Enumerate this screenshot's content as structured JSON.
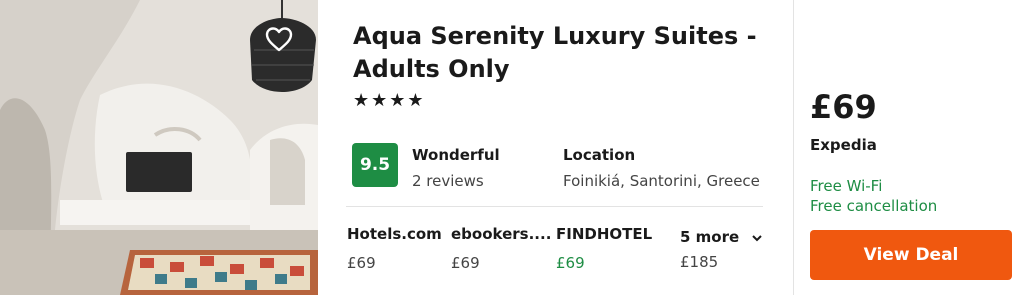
{
  "hotel": {
    "name": "Aqua Serenity Luxury Suites - Adults Only",
    "stars": "★★★★"
  },
  "rating": {
    "score": "9.5",
    "label": "Wonderful",
    "reviews": "2 reviews"
  },
  "location": {
    "label": "Location",
    "value": "Foinikiá, Santorini, Greece"
  },
  "providers": [
    {
      "name": "Hotels.com",
      "price": "£69"
    },
    {
      "name": "ebookers....",
      "price": "£69"
    },
    {
      "name": "FINDHOTEL",
      "price": "£69"
    }
  ],
  "more": {
    "label": "5 more",
    "price": "£185"
  },
  "deal": {
    "price": "£69",
    "site": "Expedia",
    "perks": [
      "Free Wi-Fi",
      "Free cancellation"
    ],
    "button_label": "View Deal"
  },
  "colors": {
    "rating_green": "#1e8d44",
    "button_orange": "#f0580f",
    "perk_green": "#1e8d44"
  },
  "icons": {
    "favorite": "heart-icon",
    "expand": "chevron-down-icon",
    "photo_lamp": "pendant-lamp",
    "photo_tv": "television"
  }
}
